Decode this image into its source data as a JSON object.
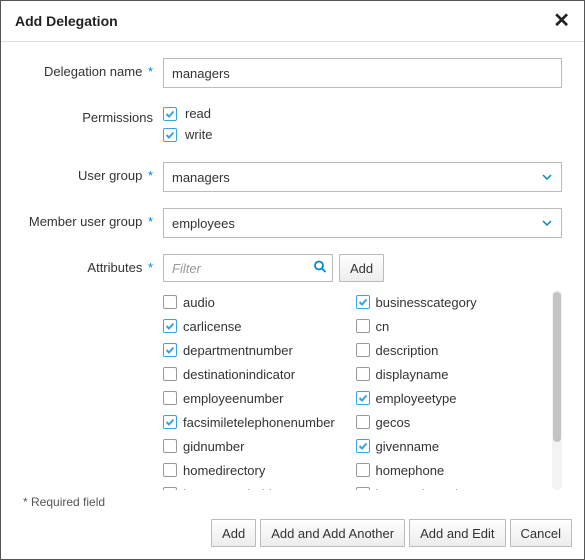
{
  "dialog": {
    "title": "Add Delegation",
    "required_note": "* Required field"
  },
  "labels": {
    "delegation_name": "Delegation name",
    "permissions": "Permissions",
    "user_group": "User group",
    "member_user_group": "Member user group",
    "attributes": "Attributes"
  },
  "form": {
    "delegation_name_value": "managers",
    "permissions": {
      "read": {
        "label": "read",
        "checked": true
      },
      "write": {
        "label": "write",
        "checked": true
      }
    },
    "user_group_value": "managers",
    "member_user_group_value": "employees",
    "filter_placeholder": "Filter",
    "attr_add_button": "Add"
  },
  "attributes": [
    {
      "label": "audio",
      "checked": false
    },
    {
      "label": "businesscategory",
      "checked": true
    },
    {
      "label": "carlicense",
      "checked": true
    },
    {
      "label": "cn",
      "checked": false
    },
    {
      "label": "departmentnumber",
      "checked": true
    },
    {
      "label": "description",
      "checked": false
    },
    {
      "label": "destinationindicator",
      "checked": false
    },
    {
      "label": "displayname",
      "checked": false
    },
    {
      "label": "employeenumber",
      "checked": false
    },
    {
      "label": "employeetype",
      "checked": true
    },
    {
      "label": "facsimiletelephonenumber",
      "checked": true
    },
    {
      "label": "gecos",
      "checked": false
    },
    {
      "label": "gidnumber",
      "checked": false
    },
    {
      "label": "givenname",
      "checked": true
    },
    {
      "label": "homedirectory",
      "checked": false
    },
    {
      "label": "homephone",
      "checked": false
    },
    {
      "label": "homepostaladdress",
      "checked": false
    },
    {
      "label": "inetuserhttpurl",
      "checked": false
    }
  ],
  "footer": {
    "add": "Add",
    "add_another": "Add and Add Another",
    "add_edit": "Add and Edit",
    "cancel": "Cancel"
  }
}
